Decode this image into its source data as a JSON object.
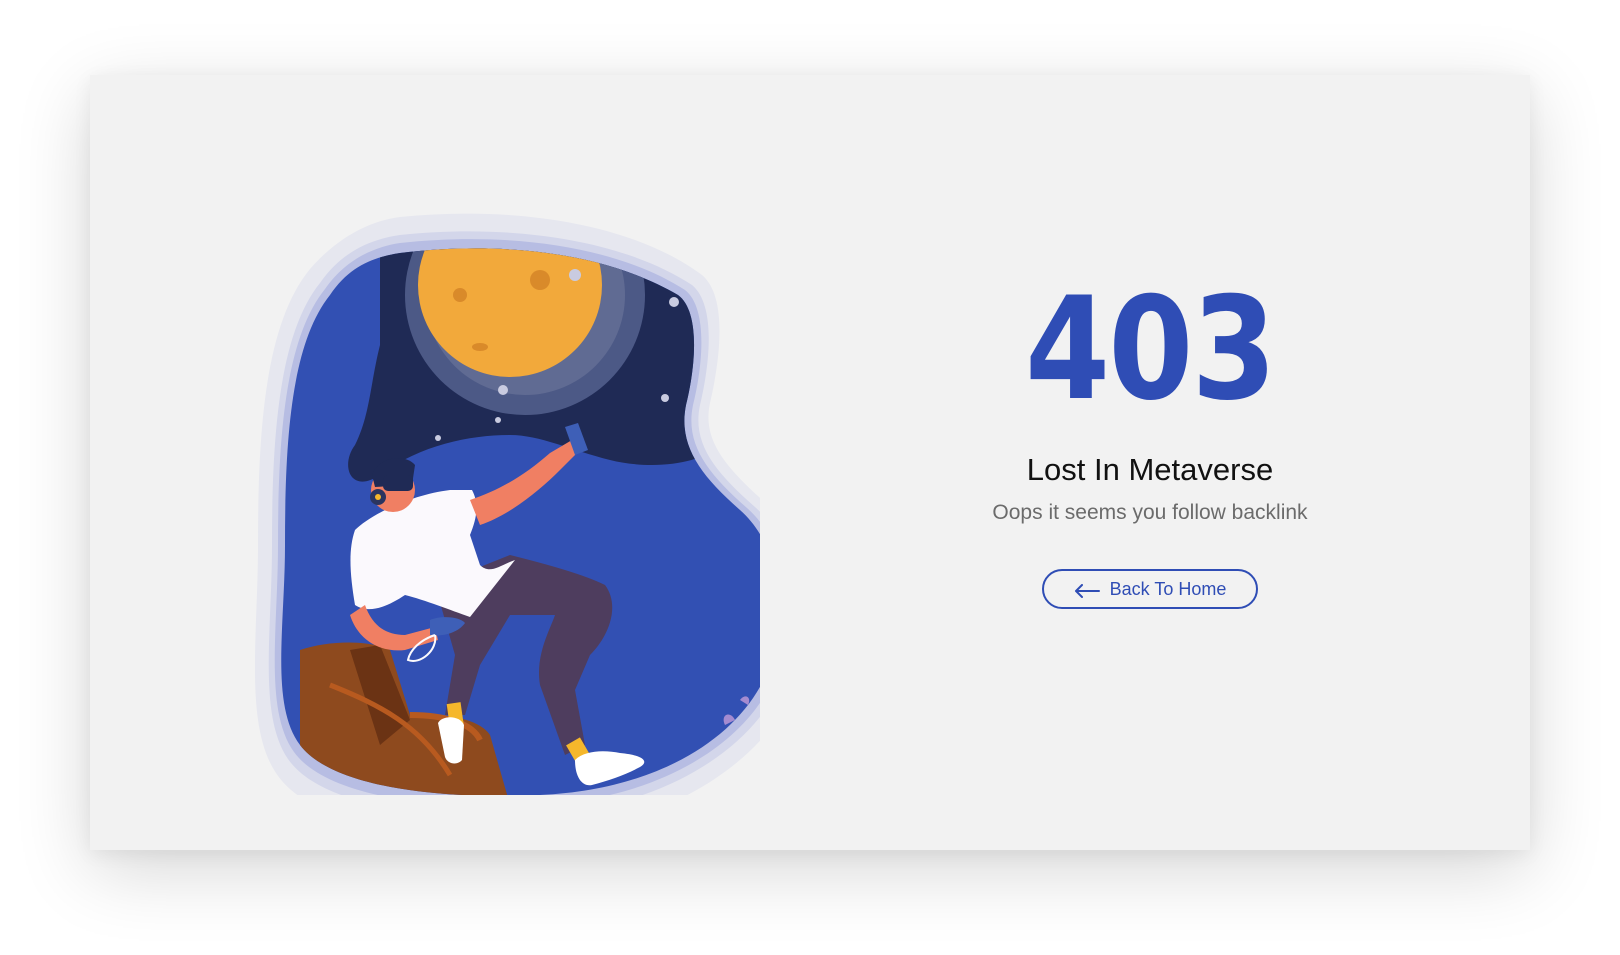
{
  "error": {
    "code": "403",
    "title": "Lost In Metaverse",
    "message": "Oops it seems you follow backlink"
  },
  "actions": {
    "back_label": "Back To Home",
    "back_icon": "arrow-left-icon"
  },
  "colors": {
    "accent": "#2f4db5",
    "background": "#f2f2f2",
    "title": "#111111",
    "message": "#6b6b6b"
  }
}
